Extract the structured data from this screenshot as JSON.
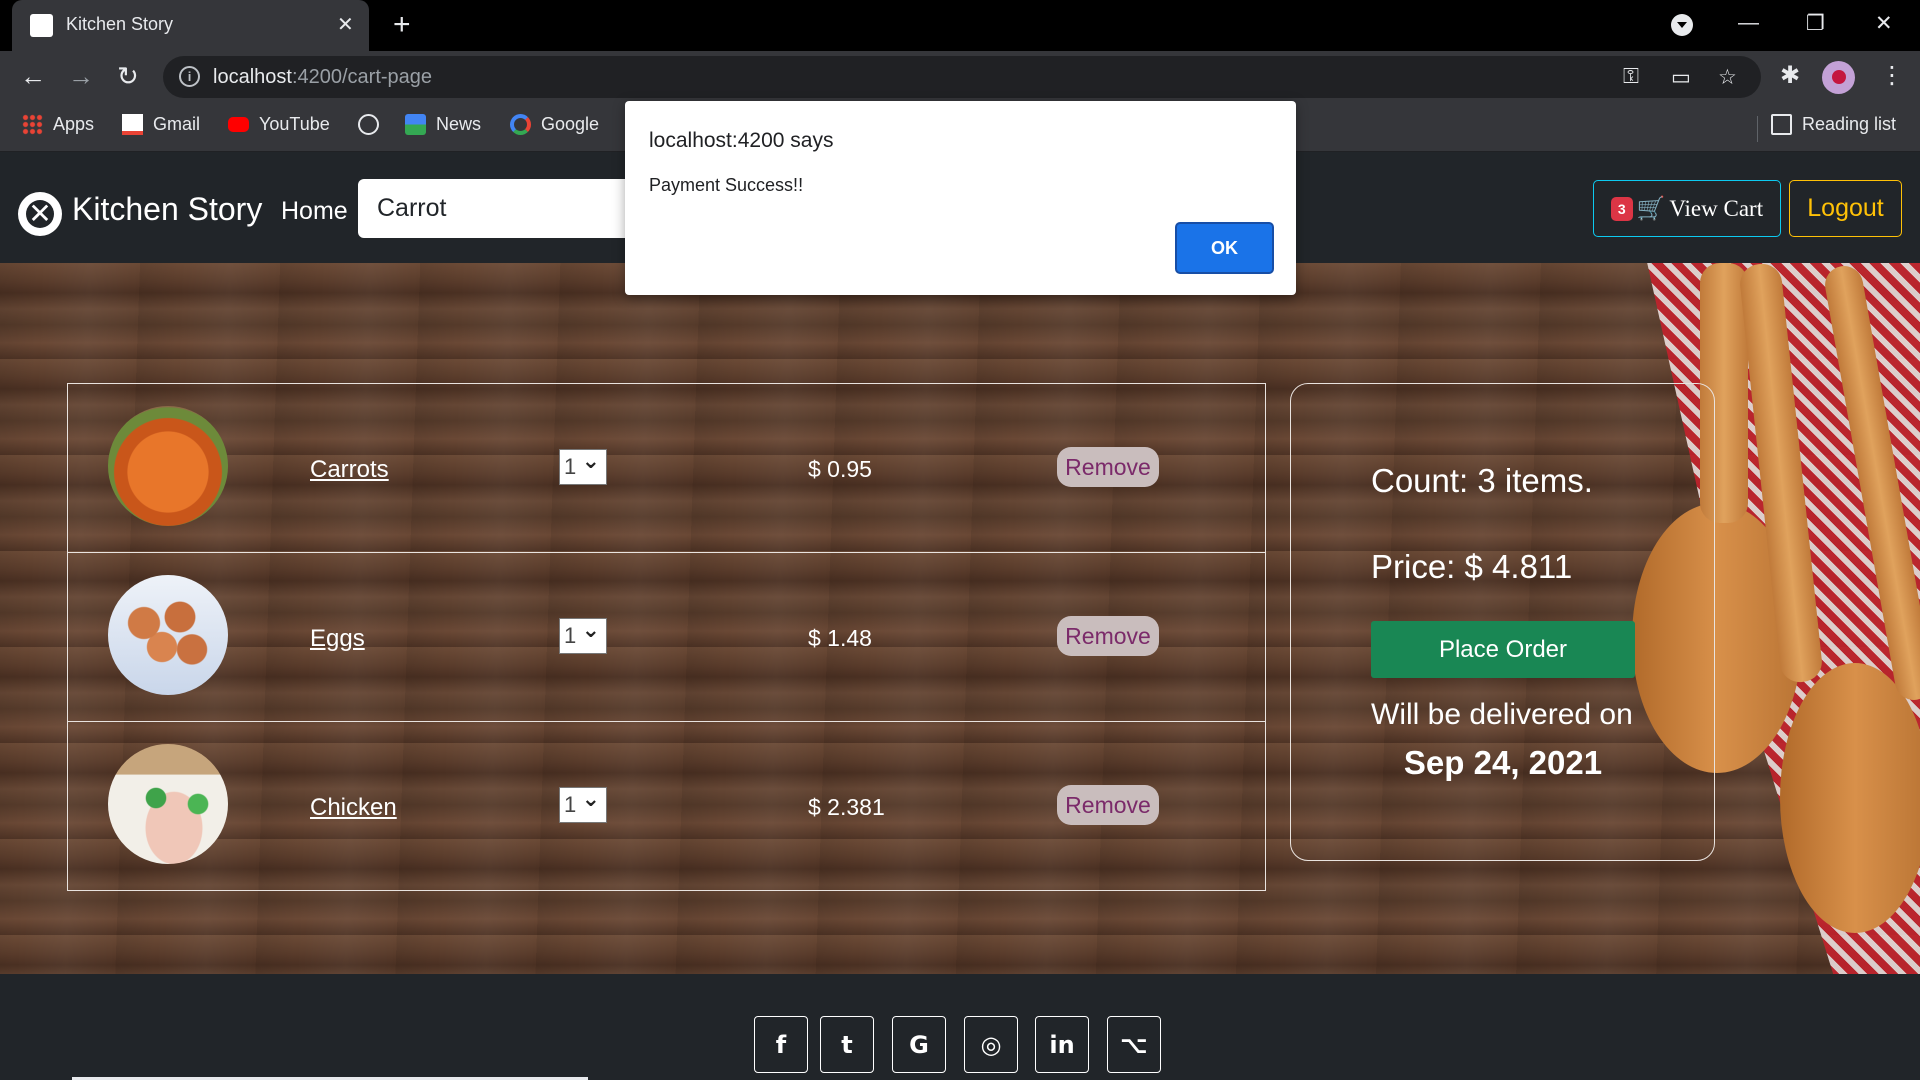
{
  "browser": {
    "tab_title": "Kitchen Story",
    "url_host": "localhost",
    "url_rest": ":4200/cart-page",
    "bookmarks": [
      {
        "label": "Apps"
      },
      {
        "label": "Gmail"
      },
      {
        "label": "YouTube"
      },
      {
        "label": ""
      },
      {
        "label": "News"
      },
      {
        "label": "Google"
      }
    ],
    "reading_list": "Reading list"
  },
  "navbar": {
    "brand": "Kitchen Story",
    "home": "Home",
    "search_value": "Carrot",
    "cart_count": "3",
    "view_cart": "View Cart",
    "logout": "Logout"
  },
  "cart": {
    "items": [
      {
        "name": "Carrots",
        "qty": "1",
        "price": "$ 0.95",
        "remove": "Remove"
      },
      {
        "name": "Eggs",
        "qty": "1",
        "price": "$ 1.48",
        "remove": "Remove"
      },
      {
        "name": "Chicken",
        "qty": "1",
        "price": "$ 2.381",
        "remove": "Remove"
      }
    ]
  },
  "summary": {
    "count": "Count: 3 items.",
    "price": "Price: $ 4.811",
    "place_order": "Place Order",
    "deliver_label": "Will be delivered on",
    "deliver_date": "Sep 24, 2021"
  },
  "dialog": {
    "title": "localhost:4200 says",
    "message": "Payment Success!!",
    "ok": "OK"
  },
  "footer": {
    "social": [
      "f",
      "t",
      "G",
      "◎",
      "in",
      "⌥"
    ]
  },
  "colors": {
    "success": "#198754",
    "info": "#0dcaf0",
    "warning": "#ffc107",
    "danger": "#dc3545",
    "dialog_button": "#1a73e8"
  }
}
